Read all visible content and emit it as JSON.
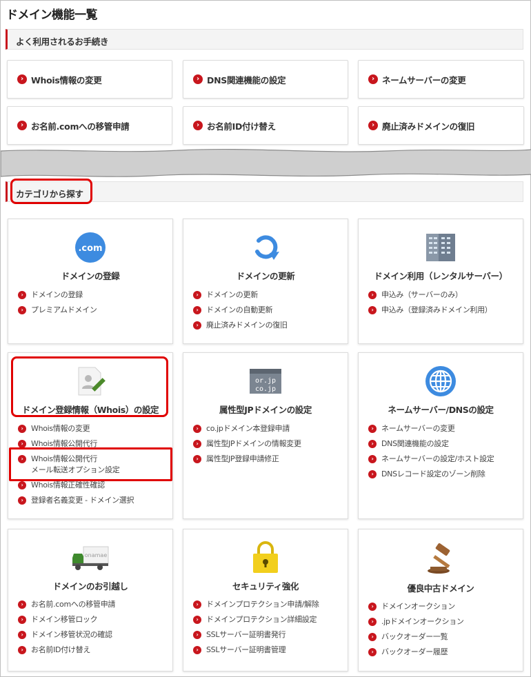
{
  "page_title": "ドメイン機能一覧",
  "frequent": {
    "header": "よく利用されるお手続き",
    "buttons": [
      "Whois情報の変更",
      "DNS関連機能の設定",
      "ネームサーバーの変更",
      "お名前.comへの移管申請",
      "お名前ID付け替え",
      "廃止済みドメインの復旧"
    ]
  },
  "category": {
    "header": "カテゴリから探す",
    "cards": [
      {
        "title": "ドメインの登録",
        "icon": "dot-com-icon",
        "icon_text": ".com",
        "items": [
          "ドメインの登録",
          "プレミアムドメイン"
        ]
      },
      {
        "title": "ドメインの更新",
        "icon": "renew-arrow-icon",
        "items": [
          "ドメインの更新",
          "ドメインの自動更新",
          "廃止済みドメインの復旧"
        ]
      },
      {
        "title": "ドメイン利用（レンタルサーバー）",
        "icon": "server-building-icon",
        "items": [
          "申込み（サーバーのみ）",
          "申込み（登録済みドメイン利用）"
        ]
      },
      {
        "title": "ドメイン登録情報（Whois）の設定",
        "icon": "profile-edit-icon",
        "items": [
          "Whois情報の変更",
          "Whois情報公開代行",
          "Whois情報公開代行",
          "Whois情報正確性確認",
          "登録者名義変更 - ドメイン選択"
        ],
        "item3_line2": "メール転送オプション設定"
      },
      {
        "title": "属性型JPドメインの設定",
        "icon": "jp-domain-icon",
        "icon_text_1": "or.jp",
        "icon_text_2": "co.jp",
        "items": [
          "co.jpドメイン本登録申請",
          "属性型JPドメインの情報変更",
          "属性型JP登録申請修正"
        ]
      },
      {
        "title": "ネームサーバー/DNSの設定",
        "icon": "globe-icon",
        "items": [
          "ネームサーバーの変更",
          "DNS関連機能の設定",
          "ネームサーバーの設定/ホスト設定",
          "DNSレコード設定のゾーン削除"
        ]
      },
      {
        "title": "ドメインのお引越し",
        "icon": "moving-truck-icon",
        "icon_text": "onamae",
        "items": [
          "お名前.comへの移管申請",
          "ドメイン移管ロック",
          "ドメイン移管状況の確認",
          "お名前ID付け替え"
        ]
      },
      {
        "title": "セキュリティ強化",
        "icon": "padlock-icon",
        "items": [
          "ドメインプロテクション申請/解除",
          "ドメインプロテクション詳細設定",
          "SSLサーバー証明書発行",
          "SSLサーバー証明書管理"
        ]
      },
      {
        "title": "優良中古ドメイン",
        "icon": "auction-gavel-icon",
        "items": [
          "ドメインオークション",
          ".jpドメインオークション",
          "バックオーダー一覧",
          "バックオーダー履歴"
        ]
      }
    ]
  },
  "colors": {
    "accent": "#c8161d",
    "highlight": "#e00000",
    "icon_blue": "#3d8be0",
    "icon_yellow": "#f2cf1d"
  }
}
